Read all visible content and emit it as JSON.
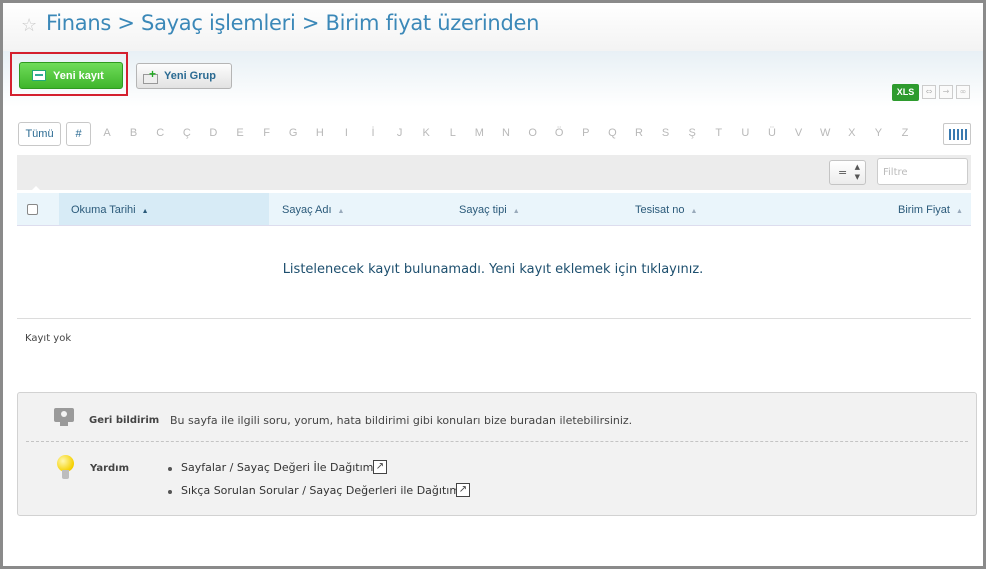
{
  "header": {
    "title": "Finans > Sayaç işlemleri > Birim fiyat üzerinden"
  },
  "toolbar": {
    "new_record_label": "Yeni kayıt",
    "new_group_label": "Yeni Grup",
    "export_xls_label": "XLS"
  },
  "alphabet": {
    "all_label": "Tümü",
    "hash_label": "#",
    "letters": [
      "A",
      "B",
      "C",
      "Ç",
      "D",
      "E",
      "F",
      "G",
      "H",
      "I",
      "İ",
      "J",
      "K",
      "L",
      "M",
      "N",
      "O",
      "Ö",
      "P",
      "Q",
      "R",
      "S",
      "Ş",
      "T",
      "U",
      "Ü",
      "V",
      "W",
      "X",
      "Y",
      "Z"
    ]
  },
  "filter": {
    "operator": "=",
    "placeholder": "Filtre"
  },
  "table": {
    "columns": [
      "Okuma Tarihi",
      "Sayaç Adı",
      "Sayaç tipi",
      "Tesisat no",
      "Birim Fiyat"
    ],
    "sorted_column": "Okuma Tarihi",
    "empty_message": "Listelenecek kayıt bulunamadı. Yeni kayıt eklemek için tıklayınız."
  },
  "record_count_text": "Kayıt yok",
  "help": {
    "feedback_label": "Geri bildirim",
    "feedback_text": "Bu sayfa ile ilgili soru, yorum, hata bildirimi gibi konuları bize buradan iletebilirsiniz.",
    "help_label": "Yardım",
    "links": [
      "Sayfalar / Sayaç Değeri İle Dağıtım",
      "Sıkça Sorulan Sorular / Sayaç Değerleri ile Dağıtım"
    ]
  },
  "icons": {
    "favorite": "star-icon",
    "feedback": "feedback-monitor-icon",
    "help": "lightbulb-icon",
    "external": "external-link-icon"
  },
  "colors": {
    "title": "#3b88b8",
    "primary_button": "#4cc338",
    "xls_badge": "#2e9b2e",
    "highlight_frame": "#d4202f"
  }
}
